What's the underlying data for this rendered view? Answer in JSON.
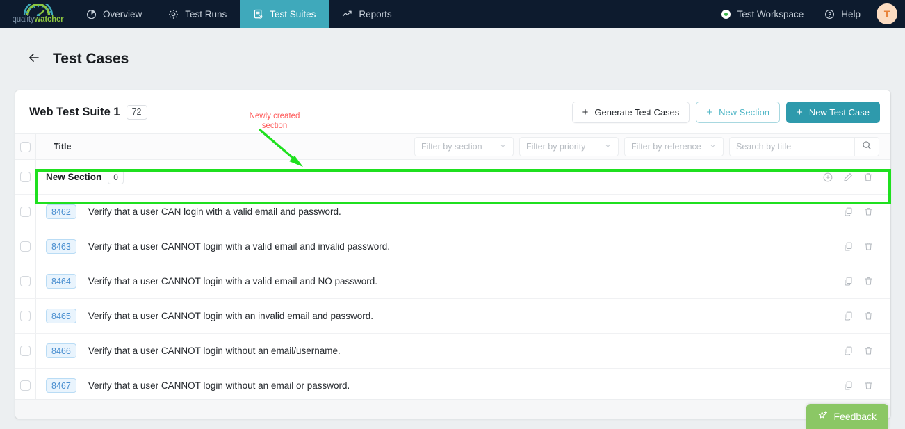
{
  "nav": {
    "logo": {
      "part1": "quality",
      "part2": "watcher"
    },
    "items": [
      {
        "label": "Overview",
        "icon": "pie-chart-icon",
        "active": false
      },
      {
        "label": "Test Runs",
        "icon": "gear-icon",
        "active": false
      },
      {
        "label": "Test Suites",
        "icon": "test-suite-icon",
        "active": true
      },
      {
        "label": "Reports",
        "icon": "chart-line-icon",
        "active": false
      }
    ],
    "workspace": "Test Workspace",
    "help": "Help",
    "avatar": "T"
  },
  "page": {
    "title": "Test Cases",
    "back_icon": "arrow-left-icon"
  },
  "card": {
    "suite_name": "Web Test Suite 1",
    "suite_count": "72",
    "buttons": {
      "generate": "Generate Test Cases",
      "new_section": "New Section",
      "new_test_case": "New Test Case",
      "plus": "+"
    },
    "table": {
      "title_header": "Title",
      "filters": [
        {
          "placeholder": "Filter by section"
        },
        {
          "placeholder": "Filter by priority"
        },
        {
          "placeholder": "Filter by reference"
        }
      ],
      "search_placeholder": "Search by title",
      "search_value": ""
    },
    "section_row": {
      "name": "New Section",
      "count": "0"
    },
    "cases": [
      {
        "id": "8462",
        "title": "Verify that a user CAN login with a valid email and password."
      },
      {
        "id": "8463",
        "title": "Verify that a user CANNOT login with a valid email and invalid password."
      },
      {
        "id": "8464",
        "title": "Verify that a user CANNOT login with a valid email and NO password."
      },
      {
        "id": "8465",
        "title": "Verify that a user CANNOT login with an invalid email and password."
      },
      {
        "id": "8466",
        "title": "Verify that a user CANNOT login without an email/username."
      },
      {
        "id": "8467",
        "title": "Verify that a user CANNOT login without an email or password."
      }
    ]
  },
  "annotation": {
    "text": "Newly created\nsection",
    "line1": "Newly created",
    "line2": "section",
    "color": "#ff5a5a",
    "arrow_color": "#1fe01f",
    "box_color": "#1fe01f"
  },
  "feedback": {
    "label": "Feedback",
    "icon": "sparkle-icon",
    "color": "#8bc765"
  },
  "colors": {
    "accent": "#2e9aac",
    "nav_bg": "#0d1b2e",
    "page_bg": "#eceff1"
  }
}
